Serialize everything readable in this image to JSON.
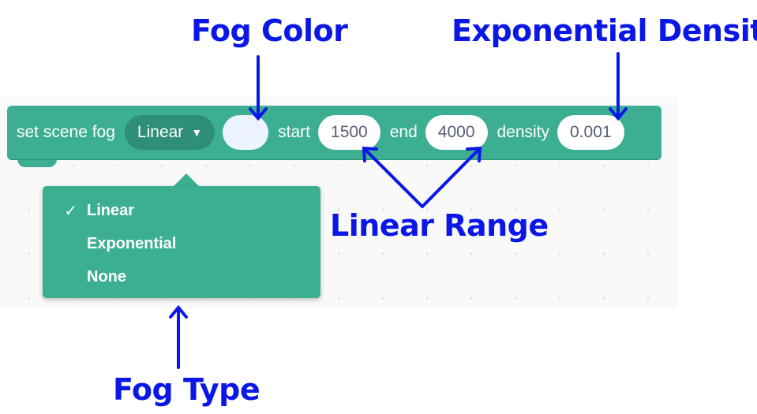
{
  "annotations": {
    "fog_color": "Fog Color",
    "exponential_density": "Exponential Density",
    "linear_range": "Linear Range",
    "fog_type": "Fog Type"
  },
  "block": {
    "label": "set scene fog",
    "fog_type_value": "Linear",
    "fog_color": "#eaf3ff",
    "start_label": "start",
    "start_value": "1500",
    "end_label": "end",
    "end_value": "4000",
    "density_label": "density",
    "density_value": "0.001"
  },
  "dropdown": {
    "items": [
      {
        "label": "Linear",
        "checked": true,
        "check": "✓"
      },
      {
        "label": "Exponential",
        "checked": false,
        "check": ""
      },
      {
        "label": "None",
        "checked": false,
        "check": ""
      }
    ]
  },
  "colors": {
    "block": "#3caf93",
    "block_dark": "#2f8e78",
    "annotation": "#0a17e6"
  }
}
